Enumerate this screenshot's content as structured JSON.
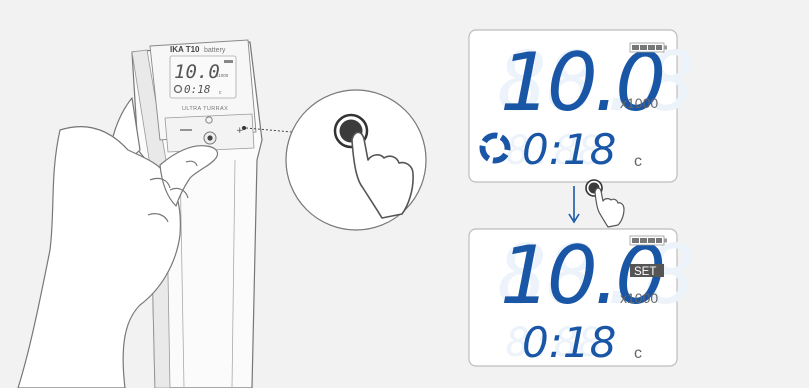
{
  "device": {
    "brand": "IKA T10",
    "brand_suffix": "battery",
    "model_label": "ULTRA TURRAX",
    "mini_display": {
      "speed": "10.0",
      "multiplier": "x1000",
      "time": "0:18",
      "time_unit": "c"
    }
  },
  "display_before": {
    "speed": "10.0",
    "multiplier": "x1000",
    "time": "0:18",
    "time_unit": "c",
    "battery_bars": 4,
    "running_indicator": true,
    "set_badge": ""
  },
  "display_after": {
    "speed": "10.0",
    "multiplier": "x1000",
    "time": "0:18",
    "time_unit": "c",
    "battery_bars": 4,
    "running_indicator": false,
    "set_badge": "SET"
  },
  "icons": {
    "zoom": "finger-press-button-icon",
    "small_press": "finger-press-button-icon",
    "transition": "arrow-down-icon"
  },
  "colors": {
    "background": "#f2f2f2",
    "lcd_digits": "#1a56a6",
    "lcd_ghost": "#edf3fa",
    "lcd_frame": "#bdbdbd",
    "outline": "#777777",
    "button": "#333333",
    "set_badge_bg": "#555555"
  }
}
